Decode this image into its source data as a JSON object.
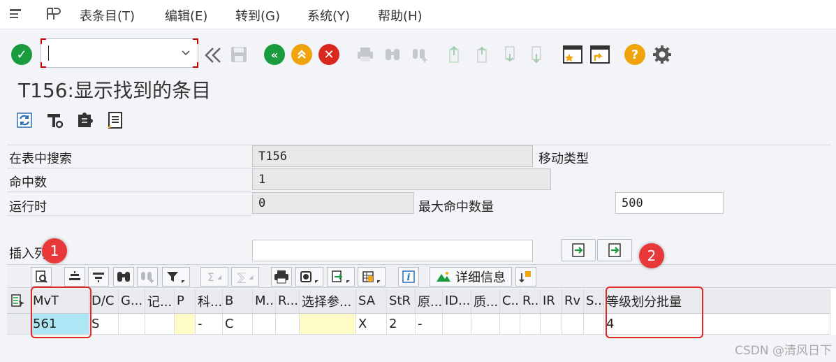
{
  "menu": {
    "items": [
      "表条目(T)",
      "编辑(E)",
      "转到(G)",
      "系统(Y)",
      "帮助(H)"
    ]
  },
  "toolbar": {
    "command_value": ""
  },
  "page": {
    "title": "T156:显示找到的条目"
  },
  "fields": {
    "search_label": "在表中搜索",
    "search_value": "T156",
    "search_desc": "移动类型",
    "hits_label": "命中数",
    "hits_value": "1",
    "runtime_label": "运行时",
    "runtime_value": "0",
    "max_hits_label": "最大命中数量",
    "max_hits_value": "500",
    "insert_col_label": "插入列",
    "insert_col_value": ""
  },
  "alv": {
    "detail_label": "详细信息"
  },
  "table": {
    "columns": [
      "MvT",
      "D/C",
      "G...",
      "记...",
      "P",
      "科...",
      "B",
      "M...",
      "R...",
      "选择参...",
      "SA",
      "StR",
      "原...",
      "ID...",
      "质...",
      "C...",
      "R...",
      "IR",
      "Rv",
      "S...",
      "等级划分批量"
    ],
    "rows": [
      [
        "561",
        "S",
        "",
        "",
        "",
        "-",
        "C",
        "",
        "",
        "",
        "X",
        "2",
        "-",
        "",
        "",
        "",
        "",
        "",
        "",
        "",
        "4"
      ]
    ]
  },
  "annotations": {
    "marker1": "1",
    "marker2": "2"
  },
  "watermark": "CSDN @清风日下",
  "colors": {
    "accent_green": "#1a9c3e",
    "accent_orange": "#f0a30a",
    "accent_red": "#d9281e",
    "highlight_red": "#e32626",
    "selected_cell": "#aee6f5",
    "input_cell": "#fffcc8"
  }
}
